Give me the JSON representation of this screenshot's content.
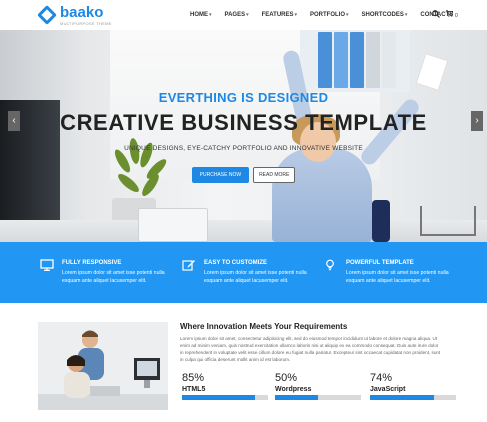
{
  "brand": {
    "name": "baako",
    "tagline": "MULTIPURPOSE THEME",
    "accent": "#1e88e5"
  },
  "nav": {
    "items": [
      {
        "label": "HOME",
        "dropdown": true
      },
      {
        "label": "PAGES",
        "dropdown": true
      },
      {
        "label": "FEATURES",
        "dropdown": true
      },
      {
        "label": "PORTFOLIO",
        "dropdown": true
      },
      {
        "label": "SHORTCODES",
        "dropdown": true
      },
      {
        "label": "CONTACTS",
        "dropdown": false
      }
    ],
    "search_icon": "search-icon",
    "cart_icon": "cart-icon",
    "cart_count": "0"
  },
  "hero": {
    "kicker": "EVERTHING IS DESIGNED",
    "title": "CREATIVE BUSINESS TEMPLATE",
    "subtitle": "UNIQUE DESIGNS, EYE-CATCHY PORTFOLIO AND INNOVATIVE WEBSITE",
    "purchase_label": "PURCHASE NOW",
    "more_label": "READ MORE",
    "prev_arrow": "‹",
    "next_arrow": "›"
  },
  "features": [
    {
      "icon": "monitor-icon",
      "title": "FULLY RESPONSIVE",
      "text": "Lorem ipsum dolor sit amet isse potenti nulla esquam ante aliquet lacusemper elit."
    },
    {
      "icon": "edit-icon",
      "title": "EASY TO CUSTOMIZE",
      "text": "Lorem ipsum dolor sit amet isse potenti nulla esquam ante aliquet lacusemper elit."
    },
    {
      "icon": "lightbulb-icon",
      "title": "POWERFUL TEMPLATE",
      "text": "Lorem ipsum dolor sit amet isse potenti nulla esquam ante aliquet lacusemper elit."
    }
  ],
  "innovation": {
    "title": "Where Innovation Meets Your Requirements",
    "text": "Lorem ipsum dolor sit amet, consectetur adipisicing elit, sed do eiusmod tempor incididunt ut labore et dolore magna aliqua. Ut enim ad minim veniam, quis nostrud exercitation ullamco laboris nisi ut aliquip ex ea commodo consequat. Duis aute irure dolor in reprehenderit in voluptate velit esse cillum dolore eu fugiat nulla pariatur. Excepteur sint occaecat cupidatat non proident, sunt in culpa qui officia deserunt mollit anim id est laborum.",
    "skills": [
      {
        "percent": "85%",
        "name": "HTML5",
        "value": 0.85
      },
      {
        "percent": "50%",
        "name": "Wordpress",
        "value": 0.5
      },
      {
        "percent": "74%",
        "name": "JavaScript",
        "value": 0.74
      }
    ]
  }
}
